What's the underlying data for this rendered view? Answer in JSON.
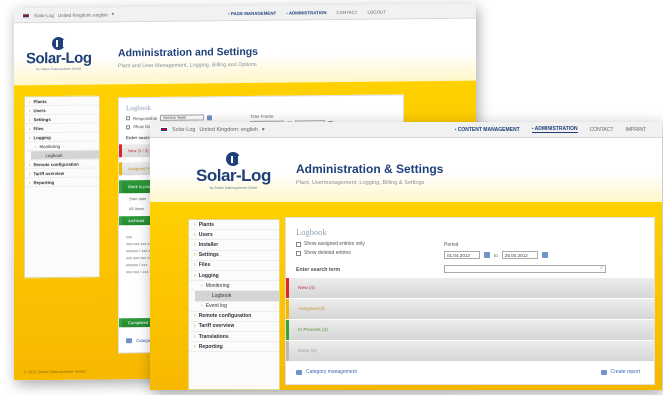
{
  "back_window": {
    "topbar": {
      "logo": "Solar-Log",
      "language": "United Kingdom: english",
      "nav": [
        {
          "label": "PAGE MANAGEMENT",
          "current": true
        },
        {
          "label": "ADMINISTRATION",
          "current": true
        },
        {
          "label": "CONTACT",
          "current": false
        },
        {
          "label": "LOGOUT",
          "current": false
        }
      ]
    },
    "header": {
      "logo": "Solar-Log",
      "logo_tagline": "by Solare Datensysteme GmbH",
      "title": "Administration and Settings",
      "subtitle": "Plant and User Management, Logging, Billing and Options"
    },
    "sidebar": [
      {
        "label": "Plants",
        "sub": false,
        "active": false
      },
      {
        "label": "Users",
        "sub": false,
        "active": false
      },
      {
        "label": "Settings",
        "sub": false,
        "active": false
      },
      {
        "label": "Files",
        "sub": false,
        "active": false
      },
      {
        "label": "Logging",
        "sub": false,
        "active": false
      },
      {
        "label": "Monitoring",
        "sub": true,
        "active": false
      },
      {
        "label": "Logbook",
        "sub": true,
        "active": true
      },
      {
        "label": "Remote configuration",
        "sub": false,
        "active": false
      },
      {
        "label": "Tariff overview",
        "sub": false,
        "active": false
      },
      {
        "label": "Reporting",
        "sub": false,
        "active": false
      }
    ],
    "content": {
      "title": "Logbook",
      "responsible_label": "Responsible",
      "responsible_value": "Service Team",
      "show_deleted": "Show Deleted Entries",
      "timeframe_label": "Time Frame",
      "search_label": "Enter search te",
      "entries": [
        {
          "label": "New (3 / 3)",
          "color": "red"
        },
        {
          "label": "Assigned P...",
          "color": "yel"
        },
        {
          "label": "Work in prog...",
          "color": "grn"
        }
      ],
      "row_labels": [
        "Start date",
        "All Items"
      ],
      "detail_lines": [
        "xxx",
        "xxx-xxx xxx xxx xxxxx",
        "xxxxxx / xxx xxx",
        "xxx xxx xxx xxx",
        "xxxxxx / xxx",
        "xxx xxx / xxx"
      ],
      "extra_entry": "Archived",
      "footer_link": "Category management",
      "footer_row": "Completed"
    },
    "copyright": "© 2012 Solare Datensysteme GmbH"
  },
  "front_window": {
    "topbar": {
      "logo": "Solar-Log",
      "language": "United Kingdom: english",
      "nav": [
        {
          "label": "CONTENT MANAGEMENT",
          "current": true,
          "selected": false
        },
        {
          "label": "ADMINISTRATION",
          "current": true,
          "selected": true
        },
        {
          "label": "CONTACT",
          "current": false,
          "selected": false
        },
        {
          "label": "IMPRINT",
          "current": false,
          "selected": false
        }
      ]
    },
    "header": {
      "logo": "Solar-Log",
      "logo_tagline": "by Solare Datensysteme GmbH",
      "title": "Administration & Settings",
      "subtitle": "Plant, Usermanagement, Logging, Billing & Settings"
    },
    "sidebar": [
      {
        "label": "Plants",
        "sub": false,
        "active": false
      },
      {
        "label": "Users",
        "sub": false,
        "active": false
      },
      {
        "label": "Installer",
        "sub": false,
        "active": false
      },
      {
        "label": "Settings",
        "sub": false,
        "active": false
      },
      {
        "label": "Files",
        "sub": false,
        "active": false
      },
      {
        "label": "Logging",
        "sub": false,
        "active": false
      },
      {
        "label": "Monitoring",
        "sub": true,
        "active": false
      },
      {
        "label": "Logbook",
        "sub": true,
        "active": true
      },
      {
        "label": "Event log",
        "sub": true,
        "active": false
      },
      {
        "label": "Remote configuration",
        "sub": false,
        "active": false
      },
      {
        "label": "Tariff overview",
        "sub": false,
        "active": false
      },
      {
        "label": "Translations",
        "sub": false,
        "active": false
      },
      {
        "label": "Reporting",
        "sub": false,
        "active": false
      }
    ],
    "content": {
      "title": "Logbook",
      "checkbox_assigned": "Show assigned entries only",
      "checkbox_deleted": "Show deleted entries",
      "period_label": "Period",
      "date_from": "01.04.2012",
      "date_to_label": "to",
      "date_to": "25.04.2012",
      "search_label": "Enter search term",
      "search_value": "",
      "entries": [
        {
          "label": "New (4)",
          "color": "red"
        },
        {
          "label": "Assigned (3)",
          "color": "yel"
        },
        {
          "label": "In Process (2)",
          "color": "grn"
        },
        {
          "label": "Done (5)",
          "color": "gry"
        }
      ],
      "footer_left": "Category management",
      "footer_right": "Create report"
    }
  },
  "colors": {
    "brand_blue": "#1e3f7a",
    "yellow": "#ffd100",
    "new": "#d9262f",
    "assigned": "#f3b500",
    "in_process": "#3aa23a"
  }
}
